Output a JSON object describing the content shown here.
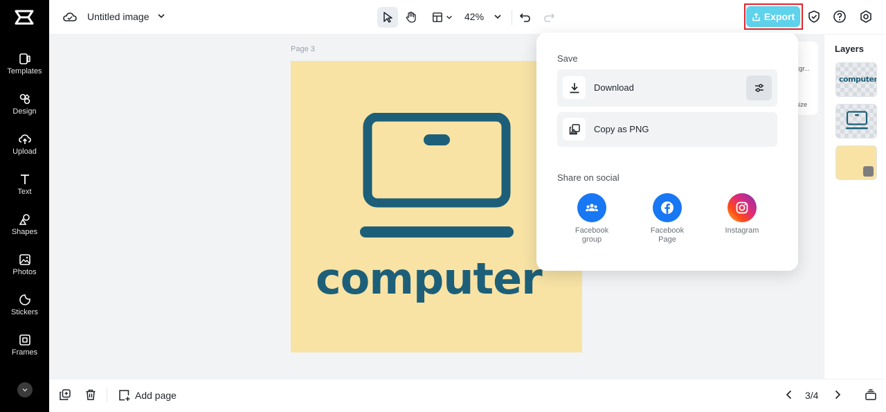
{
  "left_rail": {
    "items": [
      {
        "label": "Templates",
        "icon": "templates-icon"
      },
      {
        "label": "Design",
        "icon": "design-icon"
      },
      {
        "label": "Upload",
        "icon": "upload-icon"
      },
      {
        "label": "Text",
        "icon": "text-icon"
      },
      {
        "label": "Shapes",
        "icon": "shapes-icon"
      },
      {
        "label": "Photos",
        "icon": "photos-icon"
      },
      {
        "label": "Stickers",
        "icon": "stickers-icon"
      },
      {
        "label": "Frames",
        "icon": "frames-icon"
      }
    ]
  },
  "topbar": {
    "doc_title": "Untitled image",
    "zoom": "42%",
    "export_label": "Export",
    "accent_color": "#5fd2ec",
    "highlight_color": "#e2222a"
  },
  "canvas": {
    "page_label": "Page 3",
    "page_text": "computer",
    "page_background": "#f8e3a5",
    "ink_color": "#1d5f78"
  },
  "side_tools": {
    "bg_label": "kgr...",
    "resize_label": "size"
  },
  "layers": {
    "title": "Layers",
    "thumb_text": "computer"
  },
  "export_popup": {
    "save_heading": "Save",
    "download_label": "Download",
    "copy_label": "Copy as PNG",
    "share_heading": "Share on social",
    "social": [
      {
        "label_line1": "Facebook",
        "label_line2": "group",
        "color": "#1877f2"
      },
      {
        "label_line1": "Facebook",
        "label_line2": "Page",
        "color": "#1877f2"
      },
      {
        "label_line1": "Instagram",
        "label_line2": "",
        "color": "#dd2a7b"
      }
    ]
  },
  "bottombar": {
    "add_page_label": "Add page",
    "page_count": "3/4"
  }
}
